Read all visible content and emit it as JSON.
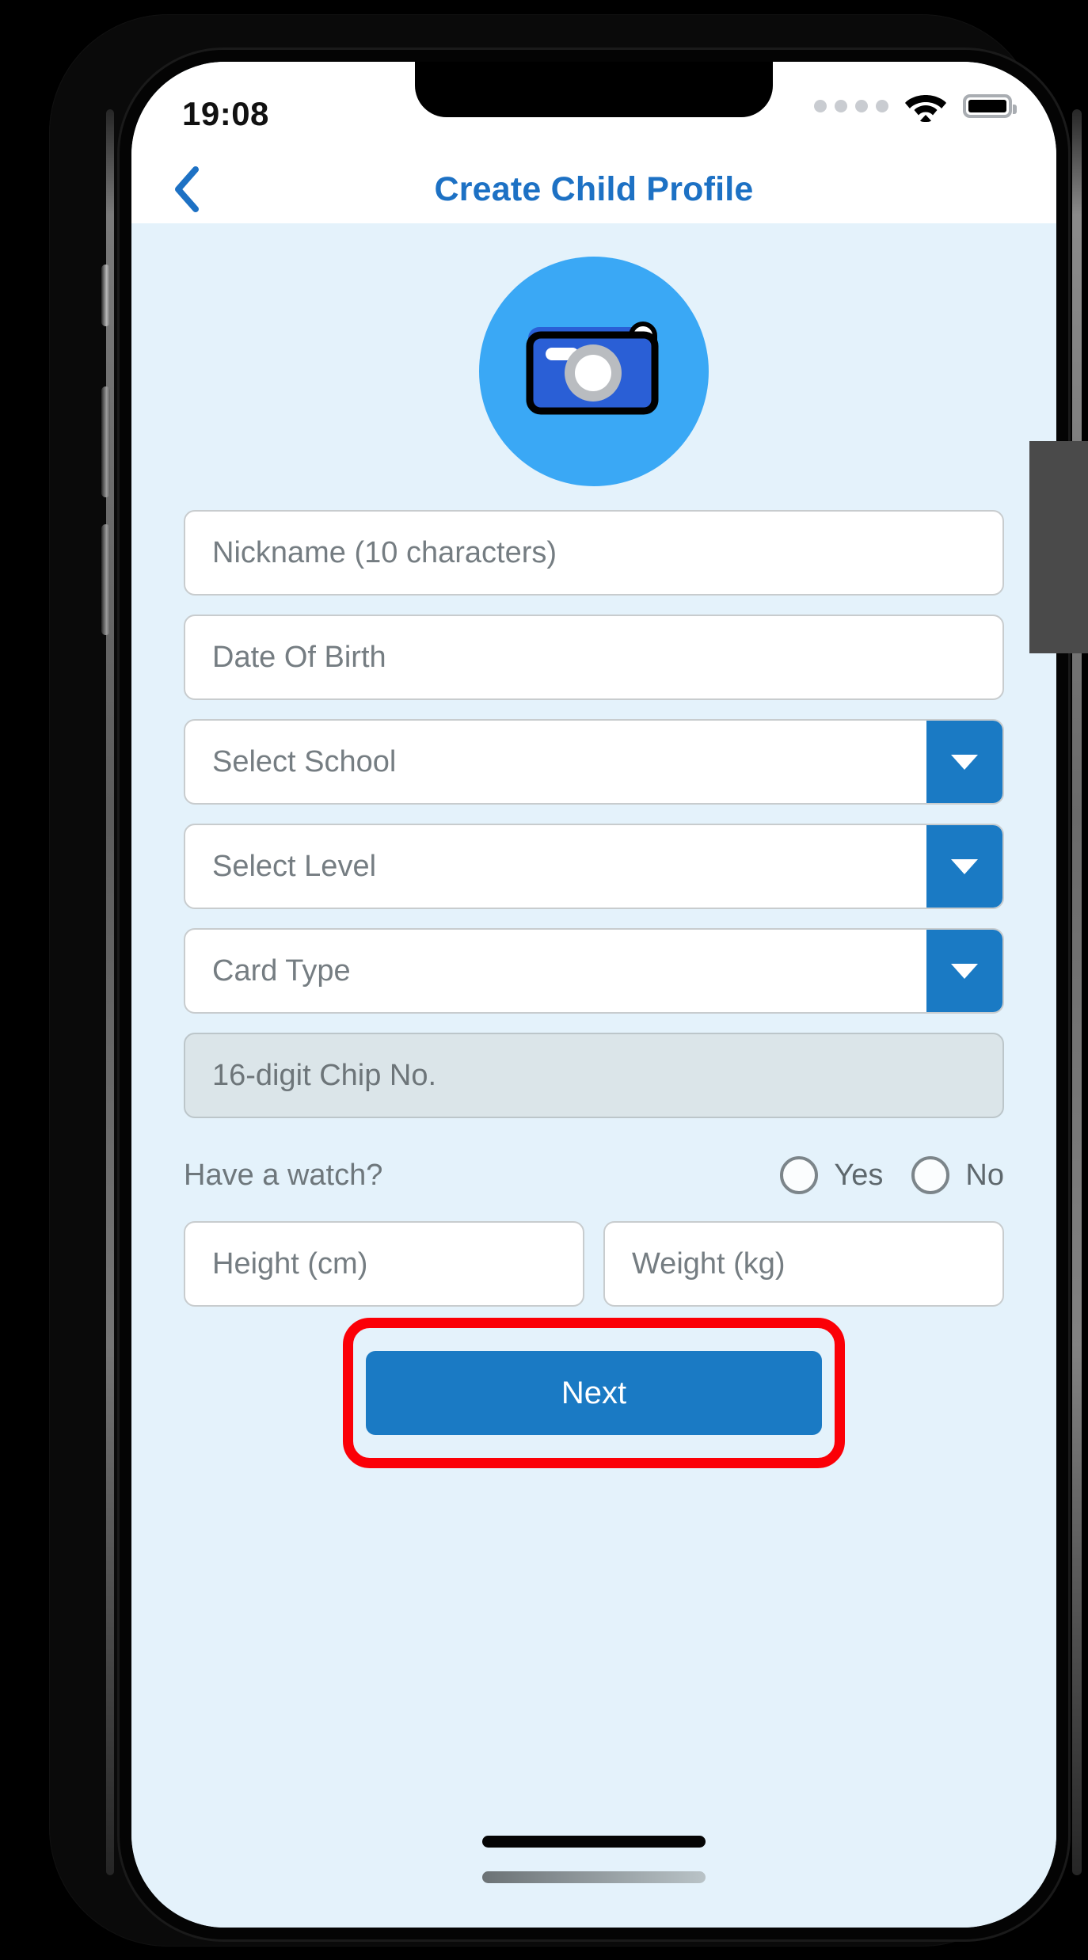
{
  "status_bar": {
    "time": "19:08",
    "signal_icon": "signal-dots-icon",
    "wifi_icon": "wifi-icon",
    "battery_icon": "battery-full-icon"
  },
  "nav": {
    "back_icon": "chevron-left-icon",
    "title": "Create Child Profile",
    "title_color": "#1d71c4"
  },
  "avatar": {
    "icon": "camera-icon",
    "circle_color": "#3aa8f5",
    "camera_body_color": "#2a5fd6"
  },
  "form": {
    "fields": [
      {
        "name": "nickname",
        "placeholder": "Nickname (10 characters)",
        "type": "text",
        "disabled": false
      },
      {
        "name": "date-of-birth",
        "placeholder": "Date Of Birth",
        "type": "text",
        "disabled": false
      },
      {
        "name": "select-school",
        "placeholder": "Select School",
        "type": "dropdown",
        "disabled": false
      },
      {
        "name": "select-level",
        "placeholder": "Select Level",
        "type": "dropdown",
        "disabled": false
      },
      {
        "name": "card-type",
        "placeholder": "Card Type",
        "type": "dropdown",
        "disabled": false
      },
      {
        "name": "chip-no",
        "placeholder": "16-digit Chip No.",
        "type": "text",
        "disabled": true
      }
    ],
    "watch_question": {
      "label": "Have a watch?",
      "options": [
        {
          "label": "Yes",
          "selected": false
        },
        {
          "label": "No",
          "selected": false
        }
      ]
    },
    "height": {
      "placeholder": "Height (cm)"
    },
    "weight": {
      "placeholder": "Weight (kg)"
    }
  },
  "actions": {
    "next_label": "Next",
    "next_color": "#1a7ac4",
    "highlight_color": "#fb0007"
  },
  "theme": {
    "page_background": "#e4f2fb",
    "bar_background": "#ffffff",
    "accent_blue": "#1a7ac4",
    "placeholder_text": "#757d82"
  }
}
